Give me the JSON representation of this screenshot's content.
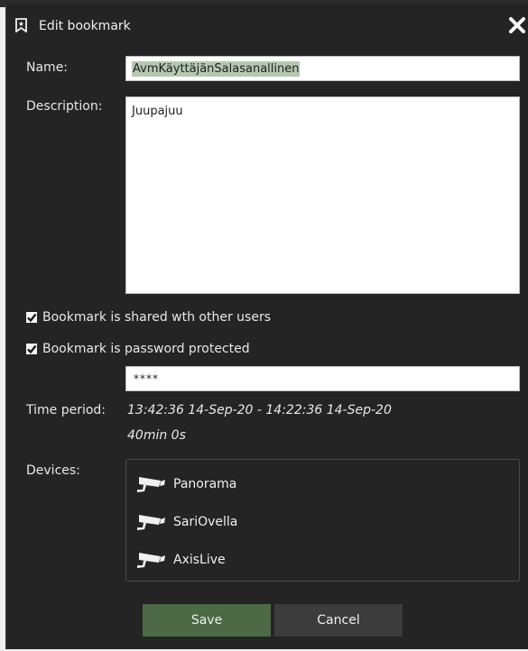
{
  "dialog": {
    "title": "Edit bookmark",
    "icons": {
      "title": "bookmark-icon",
      "close": "close-icon"
    }
  },
  "form": {
    "name_label": "Name:",
    "name_value": "AvmKäyttäjänSalasanallinen",
    "description_label": "Description:",
    "description_value": "Juupajuu",
    "shared_label": "Bookmark is shared wth other users",
    "shared_checked": true,
    "password_label": "Bookmark is password protected",
    "password_checked": true,
    "password_value": "****",
    "time_label": "Time period:",
    "time_range": "13:42:36  14-Sep-20 - 14:22:36  14-Sep-20",
    "duration": "40min 0s",
    "devices_label": "Devices:",
    "devices": [
      {
        "name": "Panorama",
        "icon": "camera-icon"
      },
      {
        "name": "SariOvella",
        "icon": "camera-icon"
      },
      {
        "name": "AxisLive",
        "icon": "camera-icon"
      }
    ]
  },
  "buttons": {
    "save": "Save",
    "cancel": "Cancel"
  },
  "colors": {
    "dialog_bg": "#242424",
    "save_bg": "#4c6a43",
    "cancel_bg": "#3c3c3c",
    "selection": "#b5c9b0"
  }
}
